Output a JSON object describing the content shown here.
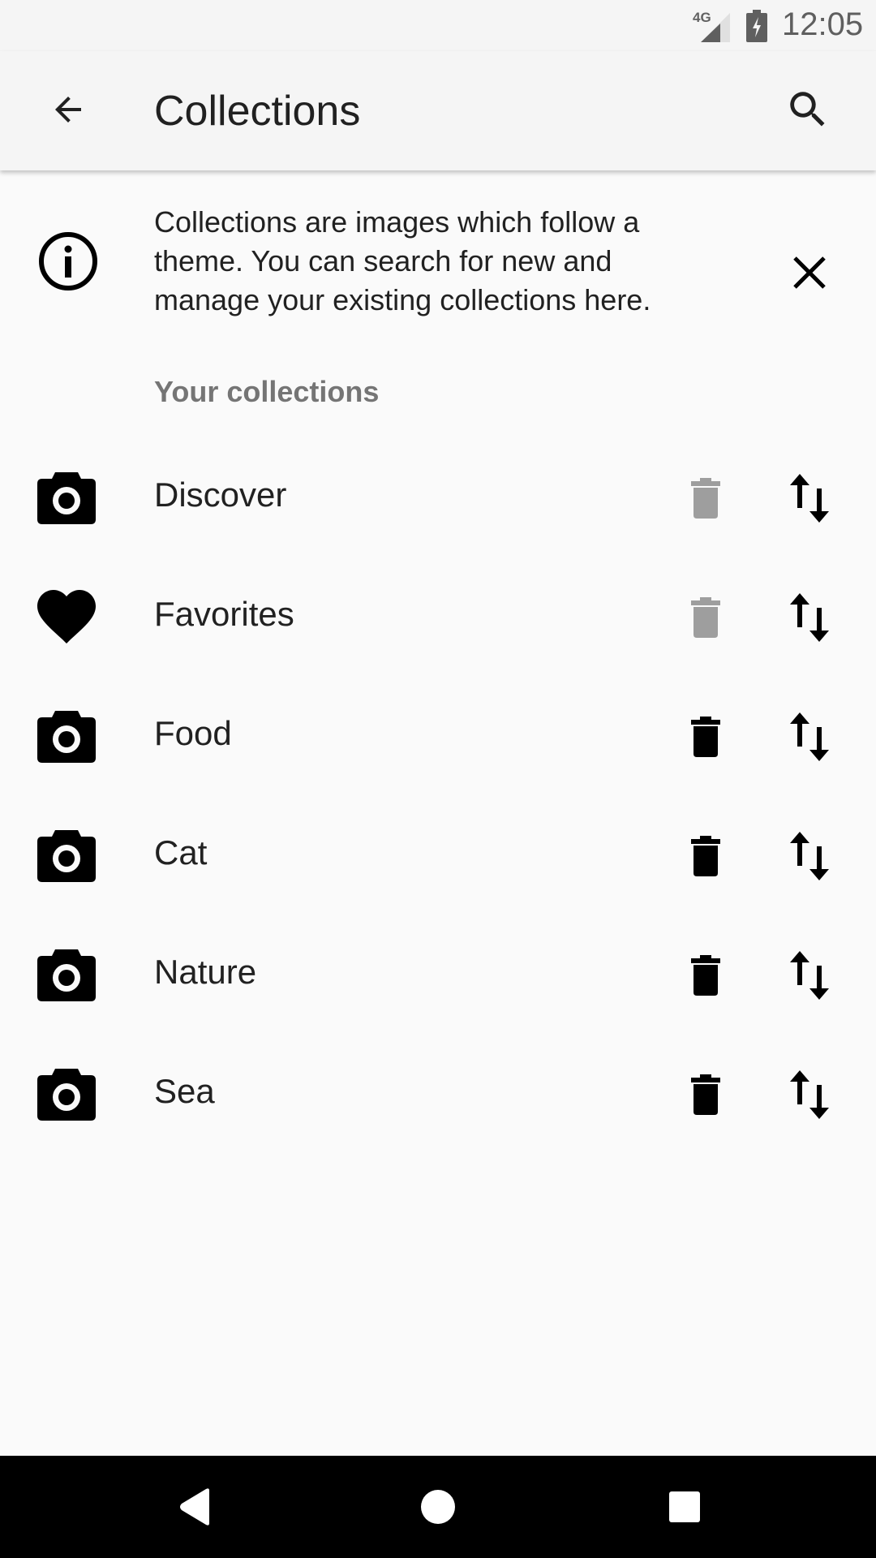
{
  "status_bar": {
    "network": "4G",
    "time": "12:05"
  },
  "app_bar": {
    "title": "Collections",
    "back_icon": "arrow-back-icon",
    "search_icon": "search-icon"
  },
  "info_banner": {
    "icon": "info-icon",
    "text": "Collections are images which follow a theme. You can search for new and manage your existing collections here.",
    "close_icon": "close-icon"
  },
  "section_header": "Your collections",
  "collections": [
    {
      "label": "Discover",
      "icon": "camera-icon",
      "deletable": false
    },
    {
      "label": "Favorites",
      "icon": "heart-icon",
      "deletable": false
    },
    {
      "label": "Food",
      "icon": "camera-icon",
      "deletable": true
    },
    {
      "label": "Cat",
      "icon": "camera-icon",
      "deletable": true
    },
    {
      "label": "Nature",
      "icon": "camera-icon",
      "deletable": true
    },
    {
      "label": "Sea",
      "icon": "camera-icon",
      "deletable": true
    }
  ],
  "colors": {
    "background": "#fafafa",
    "app_bar": "#f5f5f5",
    "icon_active": "#000000",
    "icon_disabled": "#9e9e9e",
    "section_header": "#757575"
  }
}
